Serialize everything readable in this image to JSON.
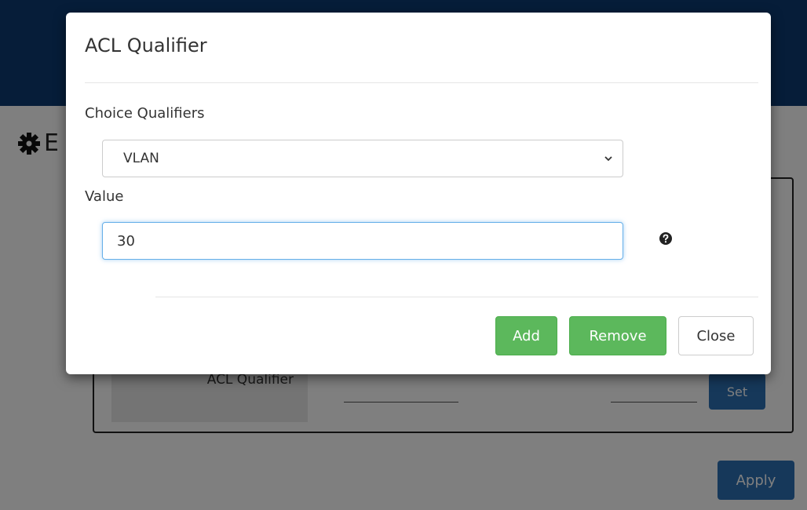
{
  "background": {
    "header_color": "#0c3b72",
    "page_title_partial": "E",
    "table_label": "ACL Qualifier",
    "set_button_label": "Set",
    "apply_button_label": "Apply"
  },
  "modal": {
    "title": "ACL Qualifier",
    "choice_label": "Choice Qualifiers",
    "choice_selected": "VLAN",
    "value_label": "Value",
    "value_input": "30",
    "help_icon": "question-circle-icon",
    "buttons": {
      "add": "Add",
      "remove": "Remove",
      "close": "Close"
    },
    "colors": {
      "primary_green": "#5cb85c",
      "focus_blue": "#66afe9"
    }
  }
}
